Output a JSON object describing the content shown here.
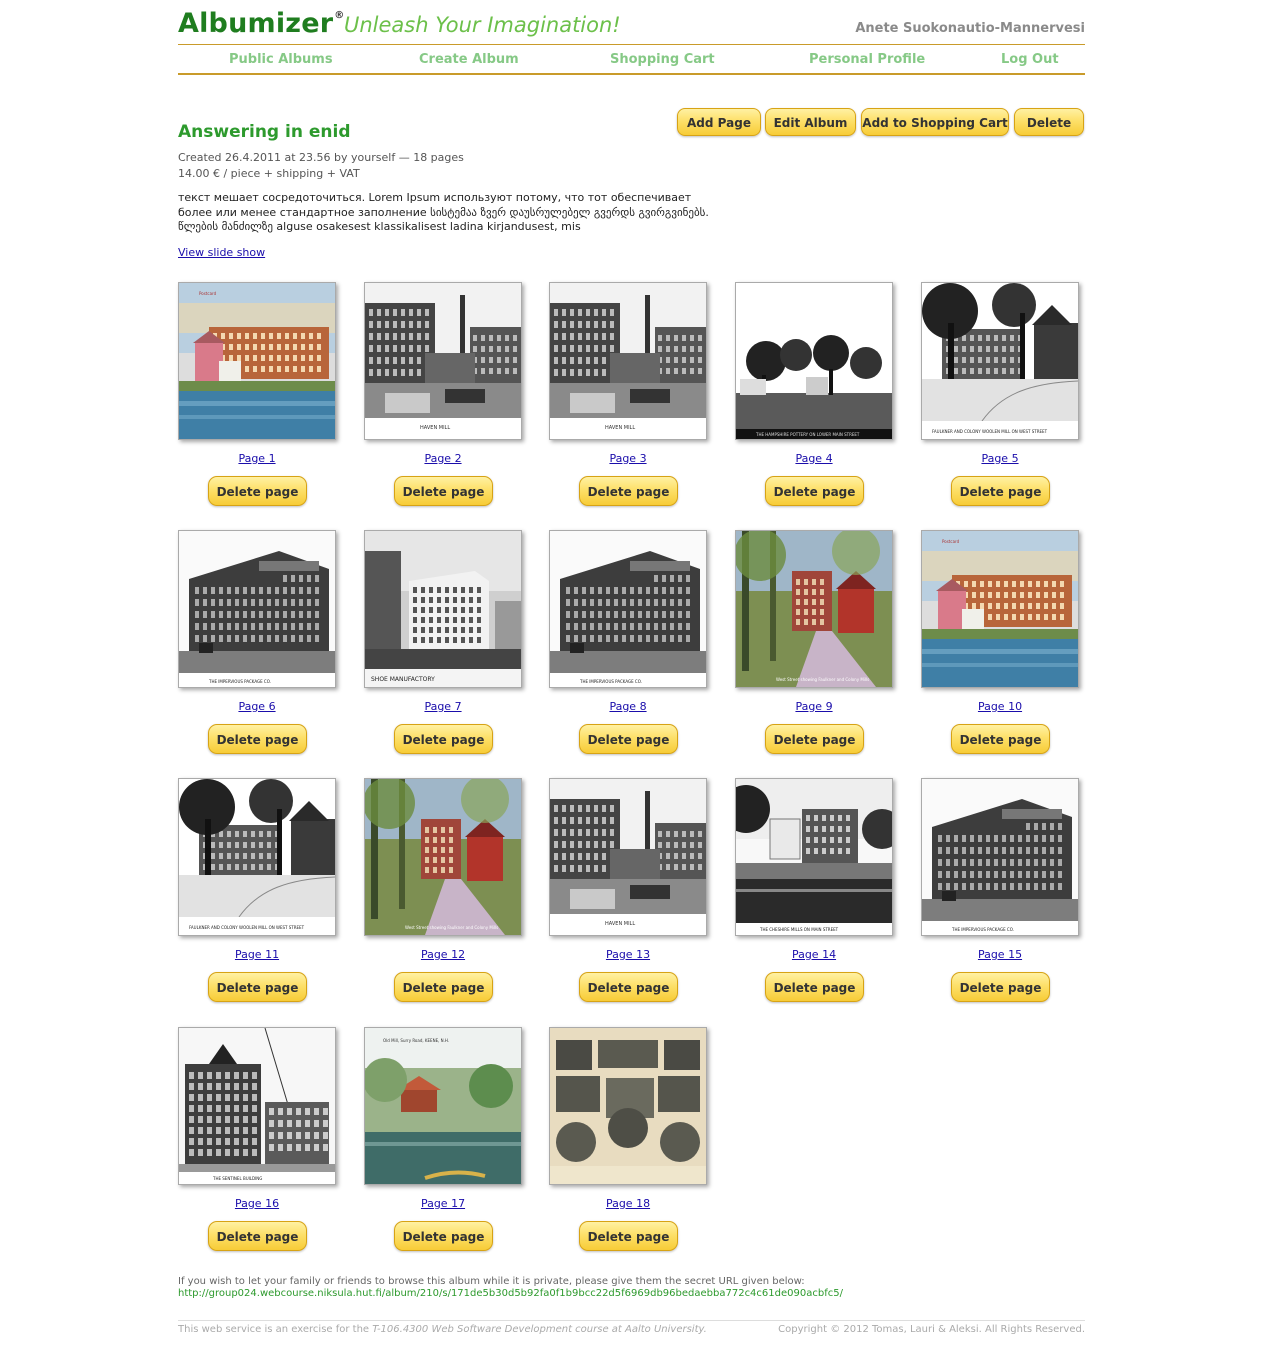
{
  "header": {
    "brand": "Albumizer",
    "registered": "®",
    "slogan": "Unleash Your Imagination!",
    "user": "Anete Suokonautio-Mannervesi"
  },
  "nav": [
    "Public Albums",
    "Create Album",
    "Shopping Cart",
    "Personal Profile",
    "Log Out"
  ],
  "album": {
    "title": "Answering in enid",
    "created": "Created 26.4.2011 at 23.56 by yourself — 18 pages",
    "price": "14.00 € / piece + shipping + VAT",
    "description": "текст мешает сосредоточиться. Lorem Ipsum используют потому, что тот обеспечивает более или менее стандартное заполнение სისტემაა ზვერ დაუსრულებელ გვერდს გვირგვინებს. წლების მანძილზე alguse osakesest klassikalisest ladina kirjandusest, mis",
    "slideshow": "View slide show"
  },
  "actions": [
    "Add Page",
    "Edit Album",
    "Add to Shopping Cart",
    "Delete"
  ],
  "pages": [
    {
      "label": "Page 1",
      "style": "color-mill"
    },
    {
      "label": "Page 2",
      "style": "bw-mill-yard"
    },
    {
      "label": "Page 3",
      "style": "bw-mill-yard"
    },
    {
      "label": "Page 4",
      "style": "bw-trees-field"
    },
    {
      "label": "Page 5",
      "style": "bw-street-trees"
    },
    {
      "label": "Page 6",
      "style": "bw-brick-factory"
    },
    {
      "label": "Page 7",
      "style": "bw-tall-building"
    },
    {
      "label": "Page 8",
      "style": "bw-brick-factory"
    },
    {
      "label": "Page 9",
      "style": "color-street"
    },
    {
      "label": "Page 10",
      "style": "color-mill"
    },
    {
      "label": "Page 11",
      "style": "bw-street-trees"
    },
    {
      "label": "Page 12",
      "style": "color-street"
    },
    {
      "label": "Page 13",
      "style": "bw-mill-yard"
    },
    {
      "label": "Page 14",
      "style": "bw-river-mill"
    },
    {
      "label": "Page 15",
      "style": "bw-brick-factory"
    },
    {
      "label": "Page 16",
      "style": "bw-corner-building"
    },
    {
      "label": "Page 17",
      "style": "color-pond"
    },
    {
      "label": "Page 18",
      "style": "sepia-collage"
    }
  ],
  "delete_page_label": "Delete page",
  "secret": {
    "text": "If you wish to let your family or friends to browse this album while it is private, please give them the secret URL given below:",
    "url": "http://group024.webcourse.niksula.hut.fi/album/210/s/171de5b30d5b92fa0f1b9bcc22d5f6969db96bedaebba772c4c61de090acbfc5/"
  },
  "footer": {
    "left_prefix": "This web service is an exercise for the",
    "left_course": "T-106.4300 Web Software Development course at",
    "left_univ": "Aalto University.",
    "right": "Copyright © 2012 Tomas, Lauri & Aleksi. All Rights Reserved."
  }
}
